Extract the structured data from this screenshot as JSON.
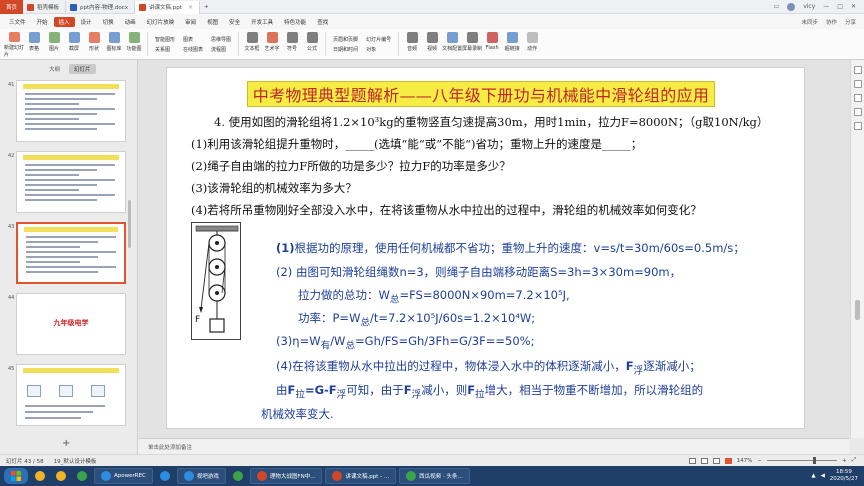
{
  "titlebar": {
    "home_label": "首页",
    "tabs": [
      {
        "label": "稻壳模板",
        "icon_color": "#d24726",
        "active": false
      },
      {
        "label": "ppt内容-物理.docx",
        "icon_color": "#2b5fb5",
        "active": false
      },
      {
        "label": "讲课文稿.ppt",
        "icon_color": "#d24726",
        "active": true
      }
    ],
    "user": "vicy"
  },
  "menubar": {
    "items": [
      "三文件",
      "开始",
      "插入",
      "设计",
      "切换",
      "动画",
      "幻灯片放映",
      "审阅",
      "视图",
      "安全",
      "开发工具",
      "特色功能",
      "查找"
    ],
    "active_index": 2,
    "right": [
      "未同步",
      "协作",
      "分享"
    ]
  },
  "ribbon": {
    "buttons": [
      {
        "label": "新建幻灯片",
        "color": "#e0532f"
      },
      {
        "label": "表格",
        "color": "#4a7fc1"
      },
      {
        "label": "图片",
        "color": "#5b9b4c"
      },
      {
        "label": "截屏",
        "color": "#4a7fc1"
      },
      {
        "label": "形状",
        "color": "#e0532f"
      },
      {
        "label": "图标库",
        "color": "#4a7fc1"
      },
      {
        "label": "功能图",
        "color": "#5b9b4c"
      }
    ],
    "cols": [
      [
        "智能图形",
        "关系图"
      ],
      [
        "图表",
        "在线图表"
      ],
      [
        "思维导图",
        "流程图"
      ]
    ],
    "buttons2": [
      {
        "label": "文本框",
        "color": "#555"
      },
      {
        "label": "艺术字",
        "color": "#d24726"
      },
      {
        "label": "符号",
        "color": "#555"
      },
      {
        "label": "公式",
        "color": "#555"
      }
    ],
    "cols2": [
      [
        "页眉和页脚",
        "日期和时间"
      ],
      [
        "幻灯片编号",
        "对象"
      ]
    ],
    "buttons3": [
      {
        "label": "音频",
        "color": "#555"
      },
      {
        "label": "视频",
        "color": "#555"
      },
      {
        "label": "文档配置",
        "color": "#4a7fc1"
      },
      {
        "label": "屏幕录制",
        "color": "#555"
      },
      {
        "label": "Flash",
        "color": "#c03030"
      },
      {
        "label": "超链接",
        "color": "#4a7fc1"
      },
      {
        "label": "动作",
        "color": "#aaa"
      }
    ]
  },
  "leftpanel": {
    "tabs": [
      "大纲",
      "幻灯片"
    ],
    "active_tab": 1,
    "slides": [
      {
        "num": "41",
        "kind": "text"
      },
      {
        "num": "42",
        "kind": "text"
      },
      {
        "num": "43",
        "kind": "text",
        "selected": true
      },
      {
        "num": "44",
        "kind": "title",
        "text": "九年级电学"
      },
      {
        "num": "45",
        "kind": "diagram"
      }
    ],
    "add_label": "+"
  },
  "slide": {
    "title": "中考物理典型题解析——八年级下册功与机械能中滑轮组的应用",
    "question": [
      "4. 使用如图的滑轮组将1.2×10³kg的重物竖直匀速提高30m，用时1min，拉力F=8000N；（g取10N/kg）",
      "(1)利用该滑轮组提升重物时，_____(选填“能“或”不能“)省功；重物上升的速度是_____；",
      "(2)绳子自由端的拉力F所做的功是多少？拉力F的功率是多少？",
      "(3)该滑轮组的机械效率为多大？",
      "(4)若将所吊重物刚好全部没入水中，在将该重物从水中拉出的过程中，滑轮组的机械效率如何变化？"
    ],
    "figure_label": "F",
    "answer": {
      "a1_num": "(1)",
      "a1": "根据功的原理，使用任何机械都不省功；重物上升的速度：v=s/t=30m/60s=0.5m/s；",
      "a2": "(2) 由图可知滑轮组绳数n=3，则绳子自由端移动距离S=3h=3×30m=90m，",
      "a2b_pre": "拉力做的总功：W",
      "a2b_sub": "总",
      "a2b_post": "=FS=8000N×90m=7.2×10⁵J,",
      "a2c_pre": "功率：P=W",
      "a2c_sub": "总",
      "a2c_post": "/t=7.2×10⁵J/60s=1.2×10⁴W;",
      "a3_pre": "(3)η=W",
      "a3_sub1": "有",
      "a3_mid": "/W",
      "a3_sub2": "总",
      "a3_post": "=Gh/FS=Gh/3Fh=G/3F==50%;",
      "a4_pre": "(4)在将该重物从水中拉出的过程中，物体浸入水中的体积逐渐减小，",
      "a4_F": "F",
      "a4_sub": "浮",
      "a4_post": "逐渐减小；",
      "a5_p1": "由",
      "a5_F1": "F",
      "a5_s1": "拉",
      "a5_eq": "=G-F",
      "a5_s2": "浮",
      "a5_p2": "可知，由于",
      "a5_F2": "F",
      "a5_s3": "浮",
      "a5_p3": "减小，则",
      "a5_F3": "F",
      "a5_s4": "拉",
      "a5_p4": "增大，相当于物重不断增加，所以滑轮组的",
      "a6": "机械效率变大."
    }
  },
  "notes_placeholder": "单击此处添加备注",
  "statusbar": {
    "slide_info": "幻灯片 43 / 58",
    "template": "19_默认设计模板",
    "zoom": "147%"
  },
  "taskbar": {
    "items": [
      {
        "label": "",
        "color": "#f0b429",
        "plain": true
      },
      {
        "label": "",
        "color": "#f0b429",
        "plain": true
      },
      {
        "label": "",
        "color": "#3aa34c",
        "plain": true
      },
      {
        "label": "ApowerREC",
        "color": "#2d8ce0",
        "plain": false
      },
      {
        "label": "",
        "color": "#2d8ce0",
        "plain": true
      },
      {
        "label": "视吧游戏",
        "color": "#2d8ce0",
        "plain": false
      },
      {
        "label": "",
        "color": "#3aa34c",
        "plain": true
      },
      {
        "label": "理物大战图FN中...",
        "color": "#d24726",
        "plain": false
      },
      {
        "label": "讲课文稿.ppt - ...",
        "color": "#d24726",
        "plain": false
      },
      {
        "label": "西瓜视频 - 头条...",
        "color": "#3aa34c",
        "plain": false
      }
    ],
    "time": "18:59",
    "date": "2020/5/27"
  }
}
